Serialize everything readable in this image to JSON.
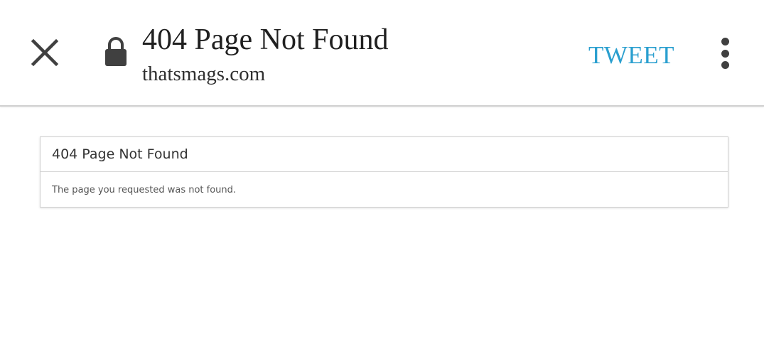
{
  "header": {
    "title": "404 Page Not Found",
    "domain": "thatsmags.com",
    "tweet_label": "TWEET",
    "icons": {
      "close": "close-icon",
      "lock": "lock-icon",
      "menu": "more-vert-icon"
    },
    "colors": {
      "tweet": "#2a9fcf",
      "icon": "#404040"
    }
  },
  "panel": {
    "heading": "404 Page Not Found",
    "message": "The page you requested was not found."
  }
}
